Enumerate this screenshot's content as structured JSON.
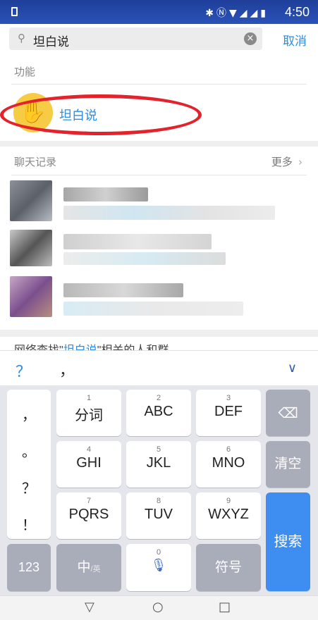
{
  "status_bar": {
    "time": "4:50",
    "icons": [
      "sim-icon",
      "bluetooth-icon",
      "nfc-icon",
      "wifi-icon",
      "signal-icon",
      "battery-icon"
    ]
  },
  "search": {
    "query": "坦白说",
    "cancel_label": "取消"
  },
  "sections": {
    "function_title": "功能",
    "function_item_label": "坦白说",
    "chat_title": "聊天记录",
    "chat_more_label": "更多",
    "web_search_prefix": "网络查找\"",
    "web_search_keyword": "坦白说",
    "web_search_suffix": "\"相关的人和群"
  },
  "ime_bar": {
    "candidate_1": "？",
    "candidate_2": "，"
  },
  "keyboard": {
    "punctuation": [
      "，",
      "。",
      "？",
      "！"
    ],
    "keys": [
      {
        "num": "1",
        "label": "分词"
      },
      {
        "num": "2",
        "label": "ABC"
      },
      {
        "num": "3",
        "label": "DEF"
      },
      {
        "num": "4",
        "label": "GHI"
      },
      {
        "num": "5",
        "label": "JKL"
      },
      {
        "num": "6",
        "label": "MNO"
      },
      {
        "num": "7",
        "label": "PQRS"
      },
      {
        "num": "8",
        "label": "TUV"
      },
      {
        "num": "9",
        "label": "WXYZ"
      }
    ],
    "clear_label": "清空",
    "search_label": "搜索",
    "num_mode_label": "123",
    "zh_label": "中",
    "zh_sub_label": "/英",
    "space_num": "0",
    "symbol_label": "符号"
  },
  "colors": {
    "accent": "#2b8ee3",
    "highlight_ring": "#e3222b",
    "status_bar": "#2a52b8",
    "icon_bg": "#f6cc44"
  }
}
